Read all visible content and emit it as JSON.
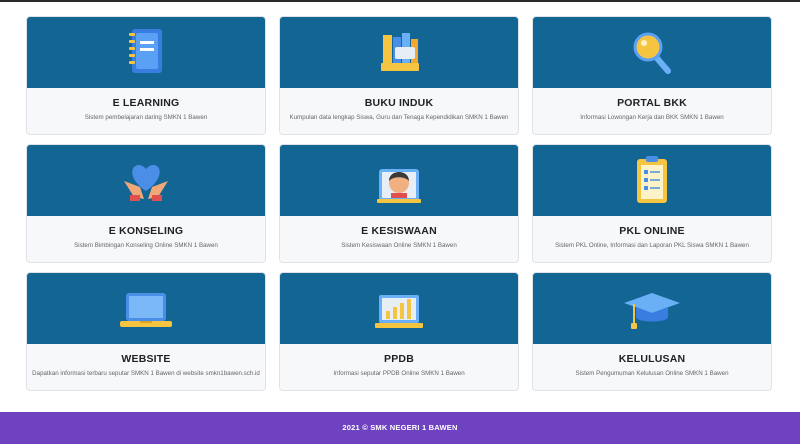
{
  "cards": [
    {
      "title": "E LEARNING",
      "desc": "Sistem pembelajaran daring SMKN 1 Bawen",
      "icon": "notebook-icon"
    },
    {
      "title": "BUKU INDUK",
      "desc": "Kumpulan data lengkap Siswa, Guru dan Tenaga Kependidikan SMKN 1 Bawen",
      "icon": "books-icon"
    },
    {
      "title": "PORTAL BKK",
      "desc": "Informasi Lowongan Kerja dan BKK SMKN 1 Bawen",
      "icon": "magnifier-icon"
    },
    {
      "title": "E KONSELING",
      "desc": "Sistem Bimbingan Konseling Online SMKN 1 Bawen",
      "icon": "heart-hands-icon"
    },
    {
      "title": "E KESISWAAN",
      "desc": "Sistem Kesiswaan Online SMKN 1 Bawen",
      "icon": "student-icon"
    },
    {
      "title": "PKL ONLINE",
      "desc": "Sistem PKL Online, Informasi dan Laporan PKL Siswa SMKN 1 Bawen",
      "icon": "clipboard-icon"
    },
    {
      "title": "WEBSITE",
      "desc": "Dapatkan informasi terbaru seputar SMKN 1 Bawen di website smkn1bawen.sch.id",
      "icon": "laptop-icon"
    },
    {
      "title": "PPDB",
      "desc": "Informasi seputar PPDB Online SMKN 1 Bawen",
      "icon": "chart-board-icon"
    },
    {
      "title": "KELULUSAN",
      "desc": "Sistem Pengumuman Kelulusan Online SMKN 1 Bawen",
      "icon": "graduation-cap-icon"
    }
  ],
  "footer": {
    "copyright": "2021 © SMK NEGERI 1 BAWEN"
  },
  "colors": {
    "banner": "#136594",
    "footer": "#6f42c1",
    "card_bg": "#f7f8fa"
  }
}
